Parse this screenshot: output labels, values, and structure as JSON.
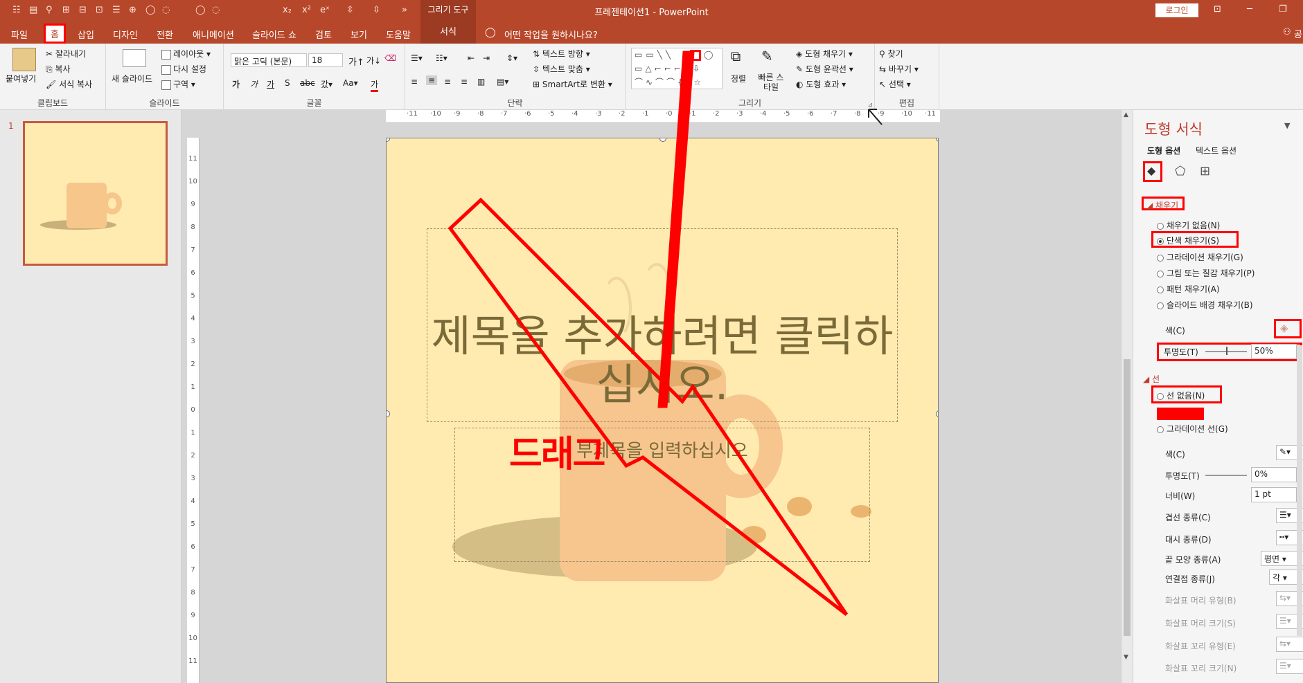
{
  "titlebar": {
    "qat_icons": [
      "☷",
      "▤",
      "⚲",
      "⊞",
      "⊟",
      "⊡",
      "☰",
      "⊕",
      "◯",
      "◌",
      "◯",
      "◌",
      "x₂",
      "x²",
      "eˣ",
      "⇳",
      "⇳",
      "»"
    ],
    "context_label": "그리기 도구",
    "title": "프레젠테이션1  -  PowerPoint",
    "login": "로그인",
    "win_buttons": [
      "⊡",
      "─",
      "❐"
    ]
  },
  "menubar": {
    "tabs": [
      "파일",
      "홈",
      "삽입",
      "디자인",
      "전환",
      "애니메이션",
      "슬라이드 쇼",
      "검토",
      "보기",
      "도움말"
    ],
    "selected": "홈",
    "context_tab": "서식",
    "tell_me": "어떤 작업을 원하시나요?",
    "share": "공"
  },
  "ribbon": {
    "clipboard": {
      "paste": "붙여넣기",
      "cut": "잘라내기",
      "copy": "복사",
      "format_painter": "서식 복사",
      "label": "클립보드"
    },
    "slides": {
      "new_slide": "새 슬라이드",
      "layout": "레이아웃",
      "reset": "다시 설정",
      "section": "구역",
      "label": "슬라이드"
    },
    "font": {
      "font_name": "맑은 고딕 (본문)",
      "font_size": "18",
      "label": "글꼴"
    },
    "paragraph": {
      "text_direction": "텍스트 방향",
      "align_text": "텍스트 맞춤",
      "smartart": "SmartArt로 변환",
      "label": "단락"
    },
    "drawing": {
      "arrange": "정렬",
      "quick_styles": "빠른 스타일",
      "fill": "도형 채우기",
      "outline": "도형 윤곽선",
      "effects": "도형 효과",
      "label": "그리기"
    },
    "editing": {
      "find": "찾기",
      "replace": "바꾸기",
      "select": "선택",
      "label": "편집"
    }
  },
  "thumbnails": {
    "number": "1"
  },
  "ruler": {
    "h_ticks": [
      "11",
      "10",
      "9",
      "8",
      "7",
      "6",
      "5",
      "4",
      "3",
      "2",
      "1",
      "0",
      "1",
      "2",
      "3",
      "4",
      "5",
      "6",
      "7",
      "8",
      "9",
      "10",
      "11"
    ],
    "v_ticks": [
      "11",
      "10",
      "9",
      "8",
      "7",
      "6",
      "5",
      "4",
      "3",
      "2",
      "1",
      "0",
      "1",
      "2",
      "3",
      "4",
      "5",
      "6",
      "7",
      "8",
      "9",
      "10",
      "11"
    ]
  },
  "slide": {
    "title_placeholder": "제목을 추가하려면 클릭하십시오.",
    "subtitle_placeholder": "부제목을 입력하십시오",
    "drag_annotation": "드래그",
    "bg_color": "#ffeab0",
    "annotation_color": "#ff0000"
  },
  "format_pane": {
    "title": "도형 서식",
    "tab_shape": "도형 옵션",
    "tab_text": "텍스트 옵션",
    "fill_header": "채우기",
    "fill_options": [
      "채우기 없음(N)",
      "단색 채우기(S)",
      "그라데이션 채우기(G)",
      "그림 또는 질감 채우기(P)",
      "패턴 채우기(A)",
      "슬라이드 배경 채우기(B)"
    ],
    "fill_selected": "단색 채우기(S)",
    "color_label": "색(C)",
    "transparency_label": "투명도(T)",
    "transparency_value": "50%",
    "line_header": "선",
    "line_options": [
      "선 없음(N)",
      "그라데이션 선(G)"
    ],
    "line_color_label": "색(C)",
    "line_transparency_label": "투명도(T)",
    "line_transparency_value": "0%",
    "width_label": "너비(W)",
    "width_value": "1 pt",
    "compound_label": "겹선 종류(C)",
    "dash_label": "대시 종류(D)",
    "cap_label": "끝 모양 종류(A)",
    "cap_value": "평면",
    "join_label": "연결점 종류(J)",
    "join_value": "각",
    "arrow_begin_type": "화살표 머리 유형(B)",
    "arrow_begin_size": "화살표 머리 크기(S)",
    "arrow_end_type": "화살표 꼬리 유형(E)",
    "arrow_end_size": "화살표 꼬리 크기(N)"
  }
}
